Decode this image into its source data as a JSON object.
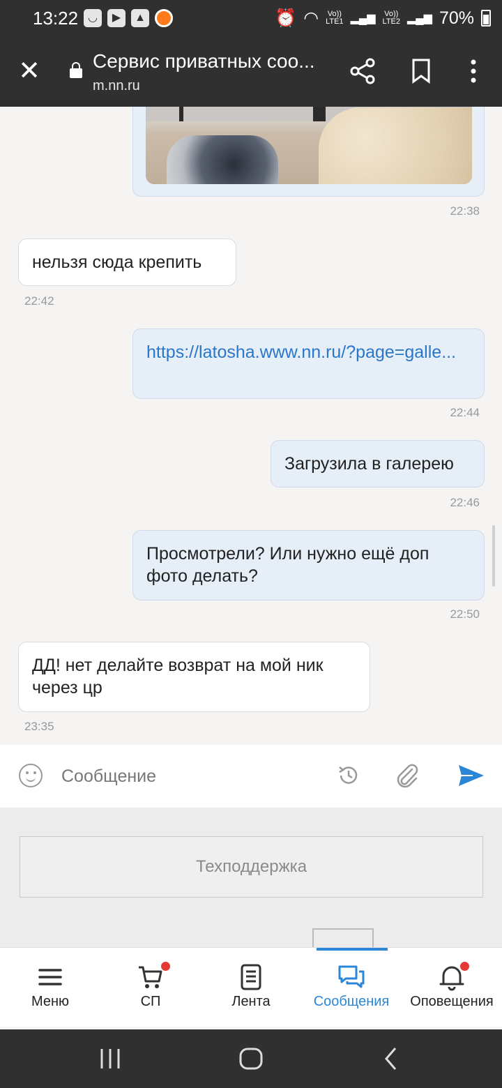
{
  "status_bar": {
    "time": "13:22",
    "battery": "70%",
    "sim1": "LTE1",
    "sim2": "LTE2",
    "volte": "Vo))"
  },
  "browser": {
    "title": "Сервис приватных соо...",
    "url": "m.nn.ru"
  },
  "messages": [
    {
      "direction": "out",
      "type": "image",
      "time": "22:38"
    },
    {
      "direction": "in",
      "text": "нельзя сюда крепить",
      "time": "22:42"
    },
    {
      "direction": "out",
      "text": "https://latosha.www.nn.ru/?page=galle...",
      "time": "22:44"
    },
    {
      "direction": "out",
      "text": "Загрузила в галерею",
      "time": "22:46"
    },
    {
      "direction": "out",
      "text": "Просмотрели? Или нужно ещё доп фото делать?",
      "time": "22:50"
    },
    {
      "direction": "in",
      "text": "ДД! нет делайте возврат на мой ник через цр",
      "time": "23:35"
    }
  ],
  "composer": {
    "placeholder": "Сообщение"
  },
  "support": {
    "label": "Техподдержка"
  },
  "nav": {
    "items": [
      {
        "label": "Меню",
        "icon": "menu-icon"
      },
      {
        "label": "СП",
        "icon": "cart-icon",
        "badge": true
      },
      {
        "label": "Лента",
        "icon": "feed-icon"
      },
      {
        "label": "Сообщения",
        "icon": "chat-icon",
        "active": true
      },
      {
        "label": "Оповещения",
        "icon": "bell-icon",
        "badge": true
      }
    ]
  },
  "colors": {
    "accent": "#2a86d6",
    "link": "#2a77c9",
    "out_bubble": "#e6eef8",
    "badge": "#e53935"
  }
}
